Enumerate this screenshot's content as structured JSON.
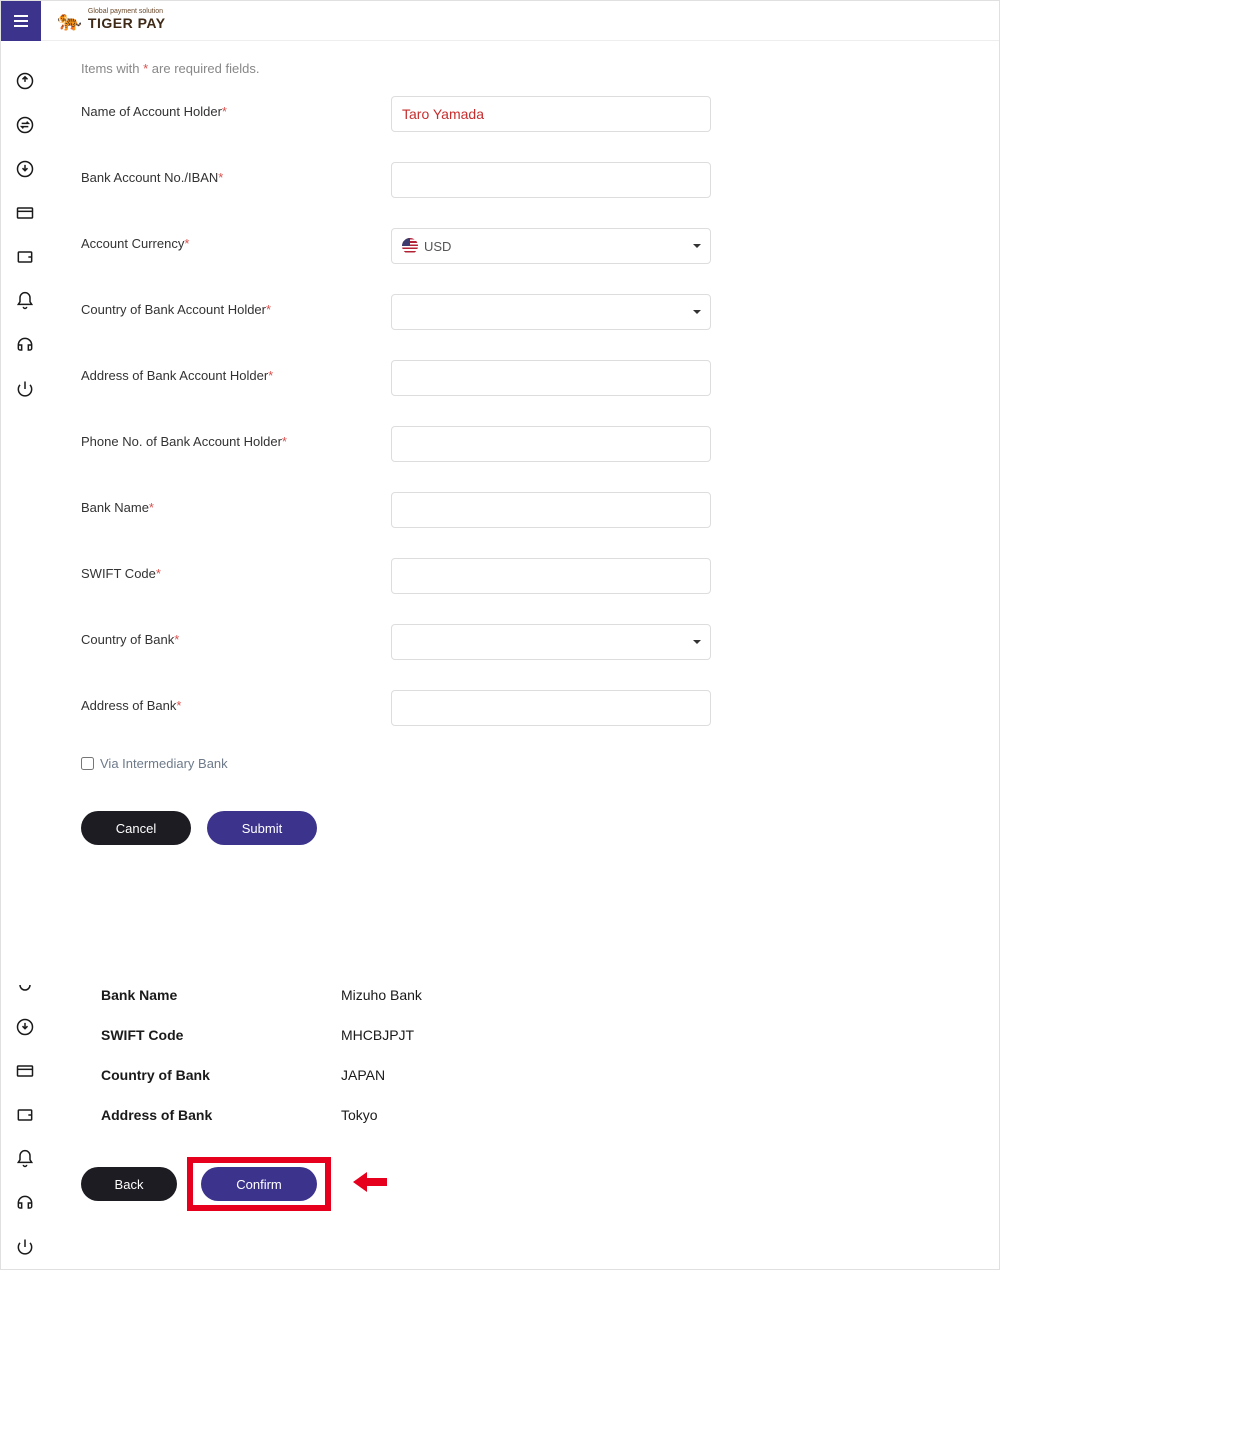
{
  "brand": {
    "tagline": "Global payment solution",
    "name": "TIGER PAY"
  },
  "form": {
    "requiredNotePrefix": "Items with ",
    "requiredNoteAst": "*",
    "requiredNoteSuffix": " are required fields.",
    "fields": {
      "accountHolder": {
        "label": "Name of Account Holder",
        "value": "Taro Yamada"
      },
      "bankAccountNo": {
        "label": "Bank Account No./IBAN",
        "value": ""
      },
      "accountCurrency": {
        "label": "Account Currency",
        "value": "USD"
      },
      "countryHolder": {
        "label": "Country of Bank Account Holder",
        "value": ""
      },
      "addressHolder": {
        "label": "Address of Bank Account Holder",
        "value": ""
      },
      "phoneHolder": {
        "label": "Phone No. of Bank Account Holder",
        "value": ""
      },
      "bankName": {
        "label": "Bank Name",
        "value": ""
      },
      "swift": {
        "label": "SWIFT Code",
        "value": ""
      },
      "countryBank": {
        "label": "Country of Bank",
        "value": ""
      },
      "addressBank": {
        "label": "Address of Bank",
        "value": ""
      }
    },
    "intermediaryLabel": "Via Intermediary Bank",
    "cancel": "Cancel",
    "submit": "Submit"
  },
  "confirm": {
    "rows": {
      "bankName": {
        "label": "Bank Name",
        "value": "Mizuho Bank"
      },
      "swift": {
        "label": "SWIFT Code",
        "value": "MHCBJPJT"
      },
      "countryBank": {
        "label": "Country of Bank",
        "value": "JAPAN"
      },
      "addressBank": {
        "label": "Address of Bank",
        "value": "Tokyo"
      }
    },
    "back": "Back",
    "confirmBtn": "Confirm"
  }
}
